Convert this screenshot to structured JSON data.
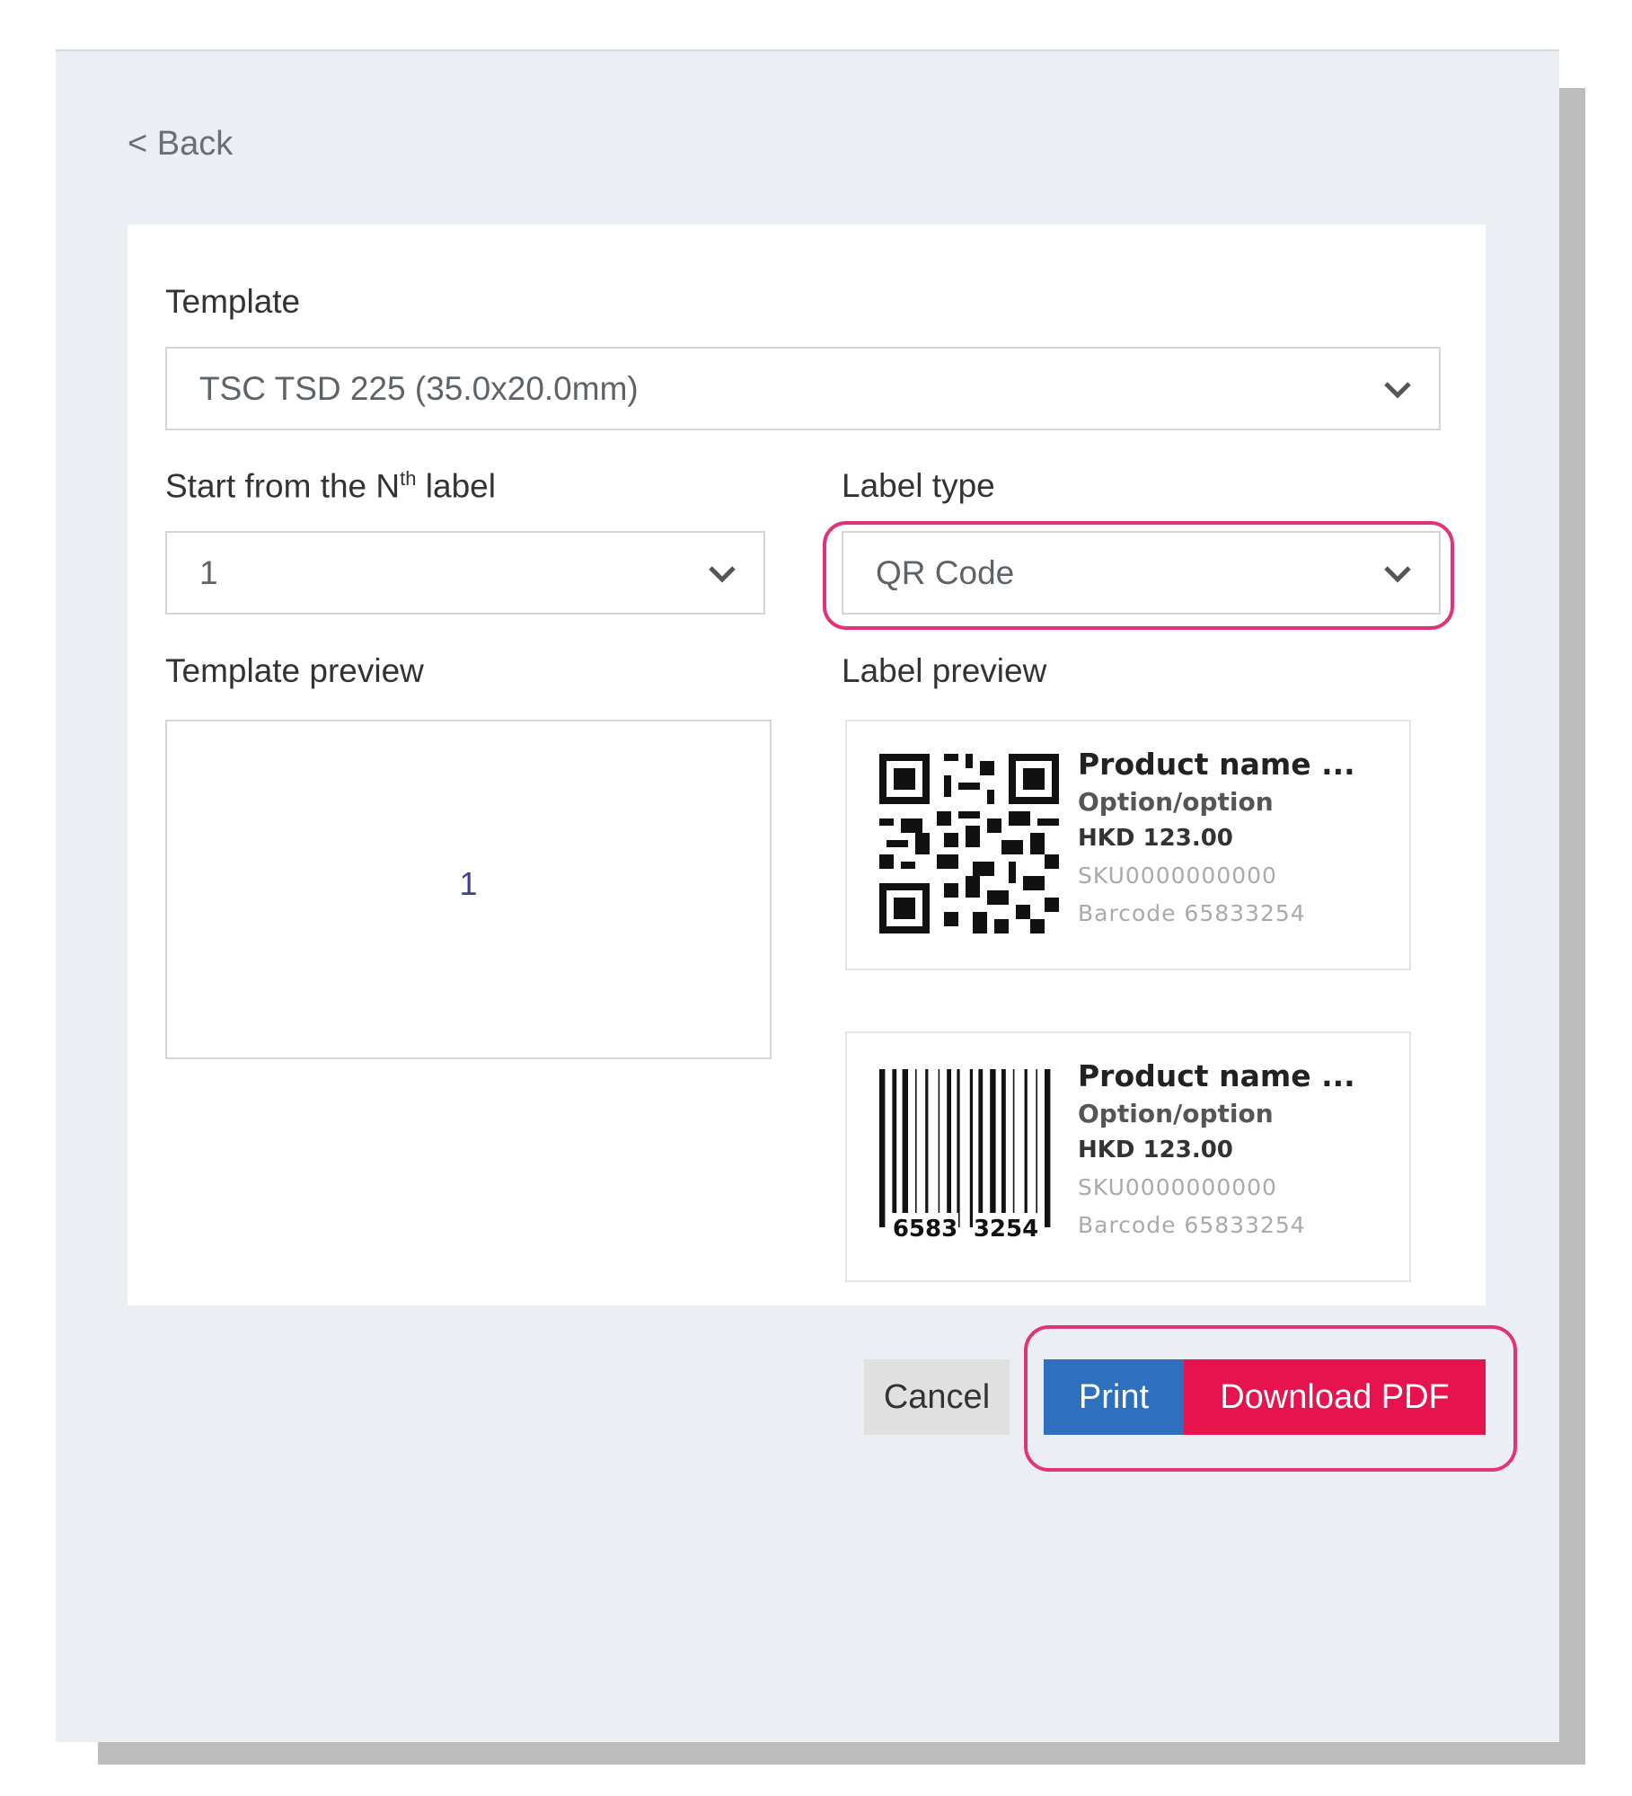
{
  "nav": {
    "back_label": "< Back"
  },
  "form": {
    "template_label": "Template",
    "template_value": "TSC TSD 225 (35.0x20.0mm)",
    "start_label_prefix": "Start from the N",
    "start_label_sup": "th",
    "start_label_suffix": " label",
    "start_value": "1",
    "label_type_label": "Label type",
    "label_type_value": "QR Code",
    "template_preview_label": "Template preview",
    "template_preview_value": "1",
    "label_preview_label": "Label preview"
  },
  "label_previews": [
    {
      "code_type": "qr-code-icon",
      "product_name": "Product name ...",
      "option": "Option/option",
      "price": "HKD 123.00",
      "sku": "SKU0000000000",
      "barcode": "Barcode  65833254"
    },
    {
      "code_type": "barcode-icon",
      "product_name": "Product name ...",
      "option": "Option/option",
      "price": "HKD 123.00",
      "sku": "SKU0000000000",
      "barcode": "Barcode  65833254",
      "barcode_digits_left": "6583",
      "barcode_digits_right": "3254"
    }
  ],
  "actions": {
    "cancel_label": "Cancel",
    "print_label": "Print",
    "download_label": "Download PDF"
  },
  "colors": {
    "highlight": "#e0337a",
    "print": "#2e6fbe",
    "download": "#e6134f",
    "background": "#ebeef2"
  }
}
